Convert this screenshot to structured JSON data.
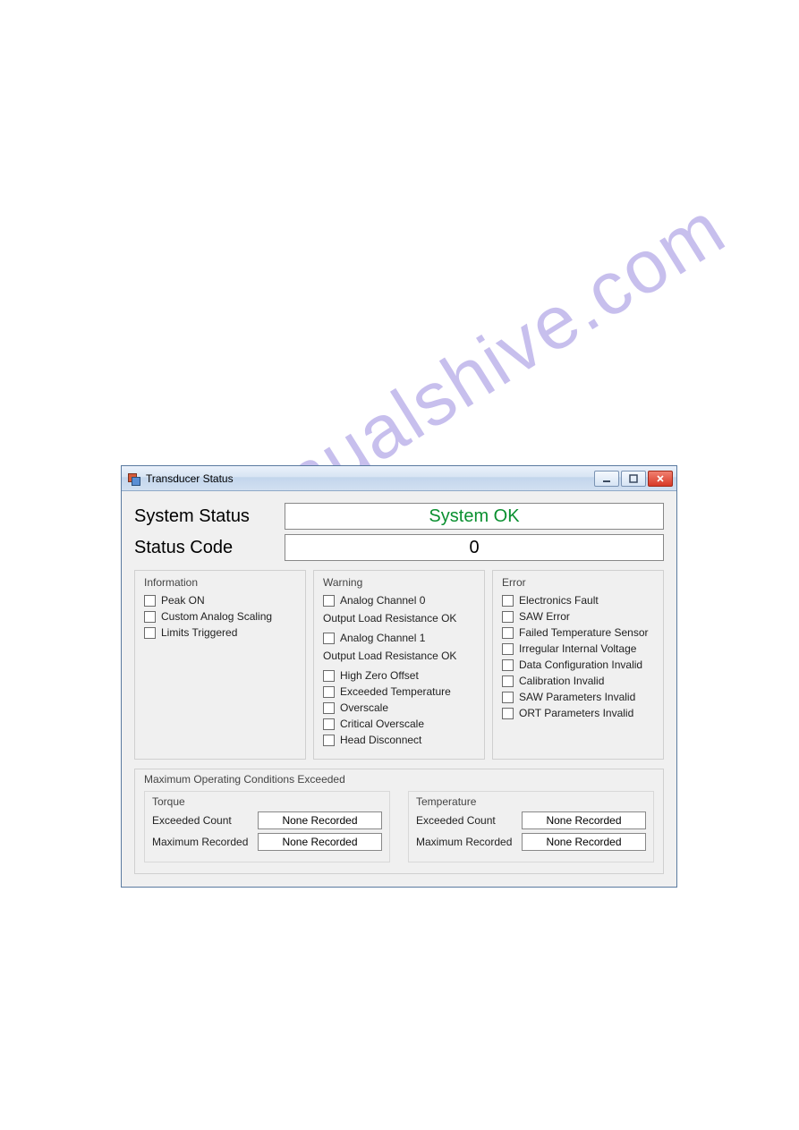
{
  "watermark": "manualshive.com",
  "window": {
    "title": "Transducer Status"
  },
  "system_status": {
    "label": "System Status",
    "value": "System OK"
  },
  "status_code": {
    "label": "Status Code",
    "value": "0"
  },
  "information": {
    "title": "Information",
    "items": [
      "Peak ON",
      "Custom Analog Scaling",
      "Limits Triggered"
    ]
  },
  "warning": {
    "title": "Warning",
    "analog0": "Analog Channel 0",
    "olr0": "Output Load Resistance OK",
    "analog1": "Analog Channel 1",
    "olr1": "Output Load Resistance OK",
    "items": [
      "High Zero Offset",
      "Exceeded Temperature",
      "Overscale",
      "Critical Overscale",
      "Head Disconnect"
    ]
  },
  "error": {
    "title": "Error",
    "items": [
      "Electronics Fault",
      "SAW Error",
      "Failed Temperature Sensor",
      "Irregular Internal Voltage",
      "Data Configuration Invalid",
      "Calibration Invalid",
      "SAW Parameters Invalid",
      "ORT Parameters Invalid"
    ]
  },
  "max_exceeded": {
    "title": "Maximum Operating Conditions Exceeded",
    "torque": {
      "title": "Torque",
      "exceeded_label": "Exceeded Count",
      "exceeded_value": "None Recorded",
      "maxrec_label": "Maximum Recorded",
      "maxrec_value": "None Recorded"
    },
    "temperature": {
      "title": "Temperature",
      "exceeded_label": "Exceeded Count",
      "exceeded_value": "None Recorded",
      "maxrec_label": "Maximum Recorded",
      "maxrec_value": "None Recorded"
    }
  }
}
